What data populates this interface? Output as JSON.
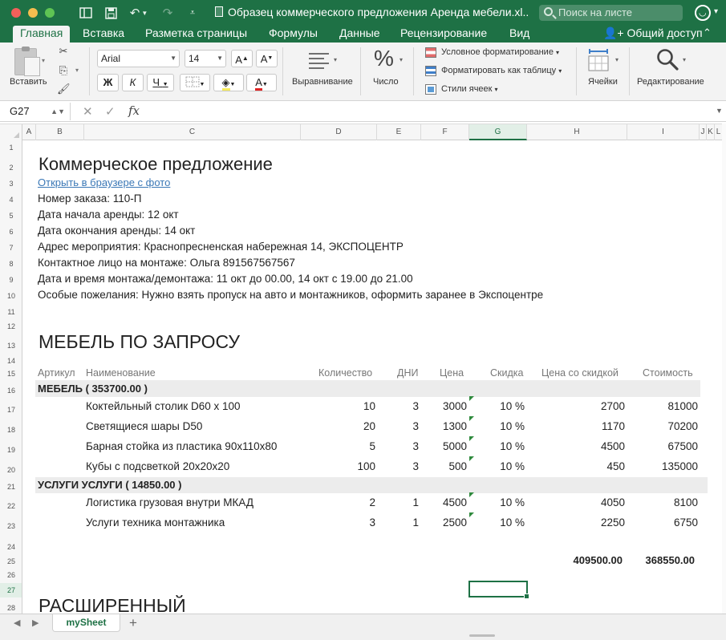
{
  "window": {
    "title": "Образец коммерческого предложения Аренда мебели.xl...",
    "search_placeholder": "Поиск на листе"
  },
  "ribbon_tabs": [
    {
      "label": "Главная",
      "active": true
    },
    {
      "label": "Вставка"
    },
    {
      "label": "Разметка страницы"
    },
    {
      "label": "Формулы"
    },
    {
      "label": "Данные"
    },
    {
      "label": "Рецензирование"
    },
    {
      "label": "Вид"
    }
  ],
  "share_label": "Общий доступ",
  "ribbon": {
    "paste_label": "Вставить",
    "font_name": "Arial",
    "font_size": "14",
    "grow_font": "A",
    "shrink_font": "A",
    "bold": "Ж",
    "italic": "К",
    "underline": "Ч",
    "font_color_glyph": "A",
    "alignment_label": "Выравнивание",
    "number_glyph": "%",
    "number_label": "Число",
    "cond_format_label": "Условное форматирование",
    "format_table_label": "Форматировать как таблицу",
    "cell_styles_label": "Стили ячеек",
    "cells_label": "Ячейки",
    "editing_label": "Редактирование",
    "accent_color": "#1e7145",
    "font_color_bar": "#e02424"
  },
  "formula_bar": {
    "name_box": "G27",
    "fx": "fx",
    "value": ""
  },
  "columns": [
    "A",
    "B",
    "C",
    "D",
    "E",
    "F",
    "G",
    "H",
    "I",
    "J",
    "K",
    "L"
  ],
  "selected_column": "G",
  "rows": [
    "1",
    "2",
    "3",
    "4",
    "5",
    "6",
    "7",
    "8",
    "9",
    "10",
    "11",
    "12",
    "13",
    "14",
    "15",
    "16",
    "17",
    "18",
    "19",
    "20",
    "21",
    "22",
    "23",
    "24",
    "25",
    "26",
    "27",
    "28"
  ],
  "selected_row": "27",
  "sheet": {
    "heading": "Коммерческое предложение",
    "link": "Открыть в браузере с фото",
    "info": [
      "Номер заказа: 110-П",
      "Дата начала аренды: 12 окт",
      "Дата окончания аренды: 14 окт",
      "Адрес мероприятия: Краснопресненская набережная 14, ЭКСПОЦЕНТР",
      "Контактное лицо на монтаже: Ольга 891567567567",
      "Дата и время монтажа/демонтажа: 11 окт до 00.00, 14 окт с 19.00 до 21.00",
      "Особые пожелания: Нужно взять пропуск на авто и монтажников, оформить заранее в Экспоцентре"
    ],
    "section_title": "МЕБЕЛЬ ПО ЗАПРОСУ",
    "table_headers": [
      "Артикул",
      "Наименование",
      "Количество",
      "ДНИ",
      "Цена",
      "Скидка",
      "Цена со скидкой",
      "Стоимость"
    ],
    "group1": "МЕБЕЛЬ ( 353700.00  )",
    "group1_items": [
      [
        "Коктейльный столик  D60 x 100",
        "10",
        "3",
        "3000",
        "10 %",
        "2700",
        "81000"
      ],
      [
        "Светящиеся шары D50",
        "20",
        "3",
        "1300",
        "10 %",
        "1170",
        "70200"
      ],
      [
        "Барная стойка из пластика 90x110x80",
        "5",
        "3",
        "5000",
        "10 %",
        "4500",
        "67500"
      ],
      [
        "Кубы с подсветкой 20x20x20",
        "100",
        "3",
        "500",
        "10 %",
        "450",
        "135000"
      ]
    ],
    "group2": "УСЛУГИ УСЛУГИ ( 14850.00  )",
    "group2_items": [
      [
        "Логистика грузовая внутри МКАД",
        "2",
        "1",
        "4500",
        "10 %",
        "4050",
        "8100"
      ],
      [
        "Услуги техника монтажника",
        "3",
        "1",
        "2500",
        "10 %",
        "2250",
        "6750"
      ]
    ],
    "total_before": "409500.00",
    "total_after": "368550.00",
    "next_section": "РАСШИРЕННЫЙ"
  },
  "sheet_tabs": [
    {
      "label": "mySheet",
      "active": true
    }
  ],
  "add_sheet": "+"
}
